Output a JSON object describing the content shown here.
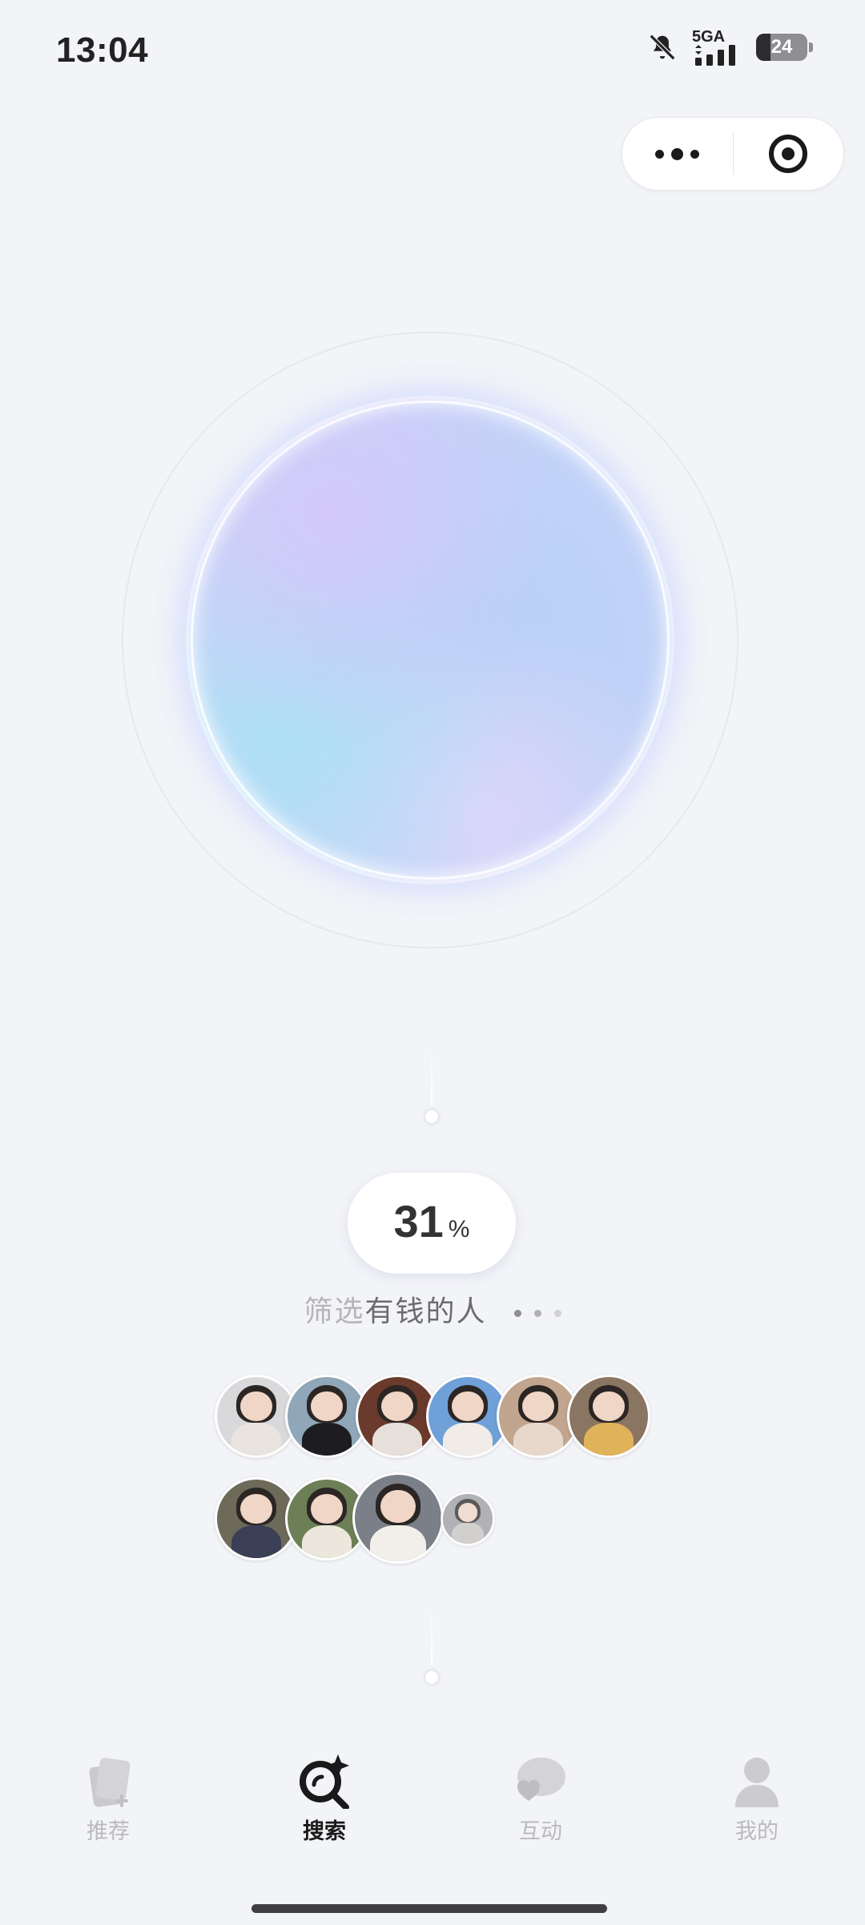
{
  "status_bar": {
    "time": "13:04",
    "network": "5GA",
    "battery": "24"
  },
  "capsule": {
    "more_icon": "more-dots-icon",
    "close_icon": "target-close-icon"
  },
  "match": {
    "percent": "31",
    "percent_sign": "%",
    "status_text_faded": "筛选",
    "status_text": "有钱的人",
    "ellipsis_colors": [
      "#8e8e93",
      "#b0b0b5",
      "#d2d2d6"
    ]
  },
  "avatars": [
    {
      "bg": "#d9d9dc",
      "body": "#e9e4e0"
    },
    {
      "bg": "#8fa7b8",
      "body": "#1d1d1f"
    },
    {
      "bg": "#6a3a2c",
      "body": "#e7e0da"
    },
    {
      "bg": "#6fa0d8",
      "body": "#f1ece8"
    },
    {
      "bg": "#c2a58e",
      "body": "#e8d8cc"
    },
    {
      "bg": "#8a7562",
      "body": "#e0b25a"
    },
    {
      "bg": "#6d6a5a",
      "body": "#3a3f55"
    },
    {
      "bg": "#6d7f56",
      "body": "#ece7dd"
    },
    {
      "bg": "#7a7f88",
      "body": "#f2efea"
    },
    {
      "bg": "#9a9ca0",
      "body": "#c8c4c0"
    }
  ],
  "tabbar": {
    "items": [
      {
        "label": "推荐",
        "icon": "cards-icon"
      },
      {
        "label": "搜索",
        "icon": "search-sparkle-icon",
        "active": true
      },
      {
        "label": "互动",
        "icon": "chat-heart-icon"
      },
      {
        "label": "我的",
        "icon": "person-icon"
      }
    ]
  }
}
